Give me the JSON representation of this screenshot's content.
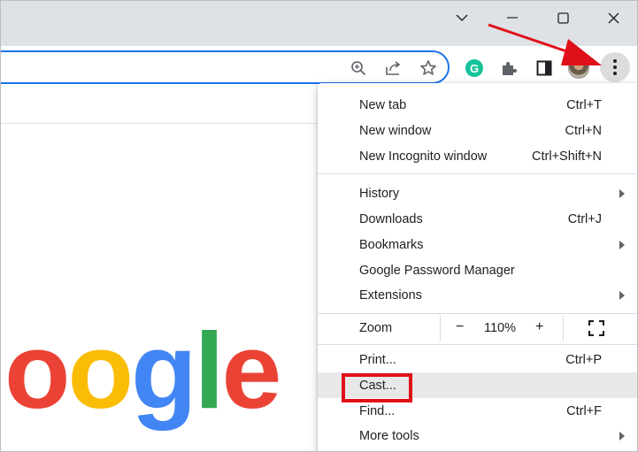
{
  "window_controls": {
    "tab_search_icon": "chevron-down-icon",
    "minimize_icon": "minimize-icon",
    "maximize_icon": "maximize-icon",
    "close_icon": "close-icon"
  },
  "toolbar": {
    "icons": [
      "zoom-icon",
      "share-icon",
      "bookmark-star-icon",
      "grammarly-icon",
      "extensions-icon",
      "side-panel-icon",
      "profile-avatar",
      "more-menu-icon"
    ],
    "grammarly_letter": "G"
  },
  "logo": {
    "letters": [
      "o",
      "o",
      "g",
      "l",
      "e"
    ],
    "colors": [
      "#ea4335",
      "#fbbc05",
      "#4285f4",
      "#34a853",
      "#ea4335"
    ]
  },
  "menu": {
    "group1": [
      {
        "label": "New tab",
        "shortcut": "Ctrl+T"
      },
      {
        "label": "New window",
        "shortcut": "Ctrl+N"
      },
      {
        "label": "New Incognito window",
        "shortcut": "Ctrl+Shift+N"
      }
    ],
    "group2": [
      {
        "label": "History",
        "shortcut": ""
      },
      {
        "label": "Downloads",
        "shortcut": "Ctrl+J"
      },
      {
        "label": "Bookmarks",
        "shortcut": ""
      },
      {
        "label": "Google Password Manager",
        "shortcut": ""
      },
      {
        "label": "Extensions",
        "shortcut": ""
      }
    ],
    "zoom": {
      "label": "Zoom",
      "minus": "−",
      "value": "110%",
      "plus": "+"
    },
    "group3": [
      {
        "label": "Print...",
        "shortcut": "Ctrl+P"
      },
      {
        "label": "Cast...",
        "shortcut": ""
      },
      {
        "label": "Find...",
        "shortcut": "Ctrl+F"
      },
      {
        "label": "More tools",
        "shortcut": ""
      }
    ]
  },
  "colors": {
    "accent": "#1a73e8",
    "annotation_red": "#e0101a",
    "titlebar": "#dee1e6"
  }
}
